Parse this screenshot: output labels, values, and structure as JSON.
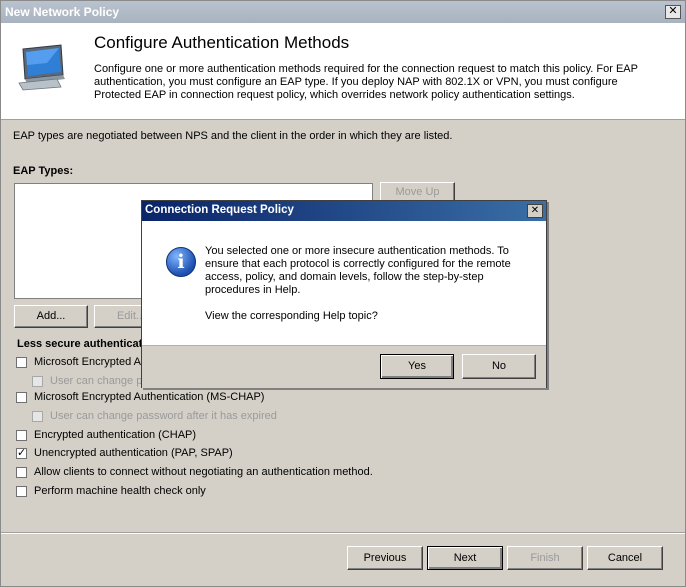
{
  "window": {
    "title": "New Network Policy",
    "close_glyph": "✕"
  },
  "banner": {
    "icon": "monitor-icon",
    "title": "Configure Authentication Methods",
    "description": "Configure one or more authentication methods required for the connection request to match this policy. For EAP authentication, you must configure an EAP type. If you deploy NAP with 802.1X or VPN, you must configure Protected EAP in connection request policy, which overrides network policy authentication settings."
  },
  "main": {
    "eap_note": "EAP types are negotiated between NPS and the client in the order in which they are listed.",
    "eap_types_label": "EAP Types:",
    "move_up_label": "Move Up",
    "add_label": "Add...",
    "edit_label": "Edit...",
    "less_secure_label": "Less secure authentication methods:",
    "options": [
      {
        "label": "Microsoft Encrypted Authentication version 2 (MS-CHAP-v2)",
        "checked": false,
        "disabled": false
      },
      {
        "label": "User can change password after it has expired",
        "checked": false,
        "disabled": true
      },
      {
        "label": "Microsoft Encrypted Authentication (MS-CHAP)",
        "checked": false,
        "disabled": false
      },
      {
        "label": "User can change password after it has expired",
        "checked": false,
        "disabled": true
      },
      {
        "label": "Encrypted authentication (CHAP)",
        "checked": false,
        "disabled": false
      },
      {
        "label": "Unencrypted authentication (PAP, SPAP)",
        "checked": true,
        "disabled": false
      },
      {
        "label": "Allow clients to connect without negotiating an authentication method.",
        "checked": false,
        "disabled": false
      },
      {
        "label": "Perform machine health check only",
        "checked": false,
        "disabled": false
      }
    ],
    "check_glyph": "✓"
  },
  "footer": {
    "previous_label": "Previous",
    "next_label": "Next",
    "finish_label": "Finish",
    "cancel_label": "Cancel"
  },
  "dialog": {
    "title": "Connection Request Policy",
    "close_glyph": "✕",
    "icon": "info-icon",
    "icon_glyph": "i",
    "message": "You selected one or more insecure authentication methods. To ensure that each protocol is correctly configured for the remote access, policy, and domain levels, follow the step-by-step procedures in Help.",
    "question": "View the corresponding Help topic?",
    "yes_label": "Yes",
    "no_label": "No"
  }
}
